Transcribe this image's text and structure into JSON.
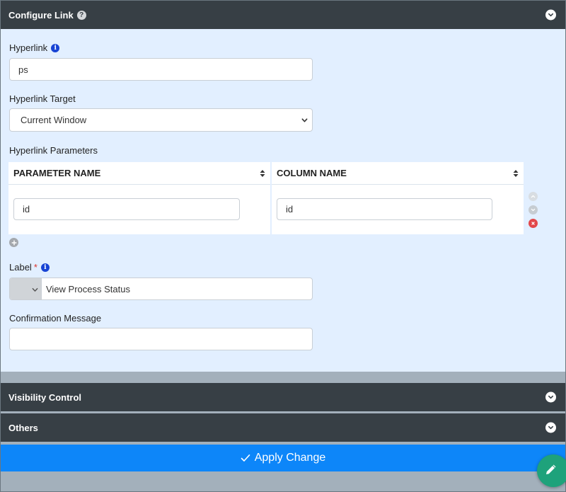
{
  "configure_link": {
    "title": "Configure Link",
    "help_glyph": "?",
    "hyperlink": {
      "label": "Hyperlink",
      "value": "ps"
    },
    "hyperlink_target": {
      "label": "Hyperlink Target",
      "value": "Current Window"
    },
    "hyperlink_parameters": {
      "label": "Hyperlink Parameters",
      "columns": [
        "PARAMETER NAME",
        "COLUMN NAME"
      ],
      "rows": [
        {
          "parameter_name": "id",
          "column_name": "id"
        }
      ]
    },
    "label_field": {
      "label": "Label",
      "required_mark": "*",
      "value": "View Process Status"
    },
    "confirmation_message": {
      "label": "Confirmation Message",
      "value": ""
    }
  },
  "sections": {
    "visibility_control": "Visibility Control",
    "others": "Others"
  },
  "apply_button": {
    "label": "Apply Change"
  },
  "info_glyph": "i",
  "colors": {
    "header_bg": "#373f45",
    "body_bg": "#e2efff",
    "apply_bg": "#0d86f9",
    "fab_bg": "#1ea27b",
    "info_blue": "#1743d4",
    "remove_red": "#e2474a"
  }
}
